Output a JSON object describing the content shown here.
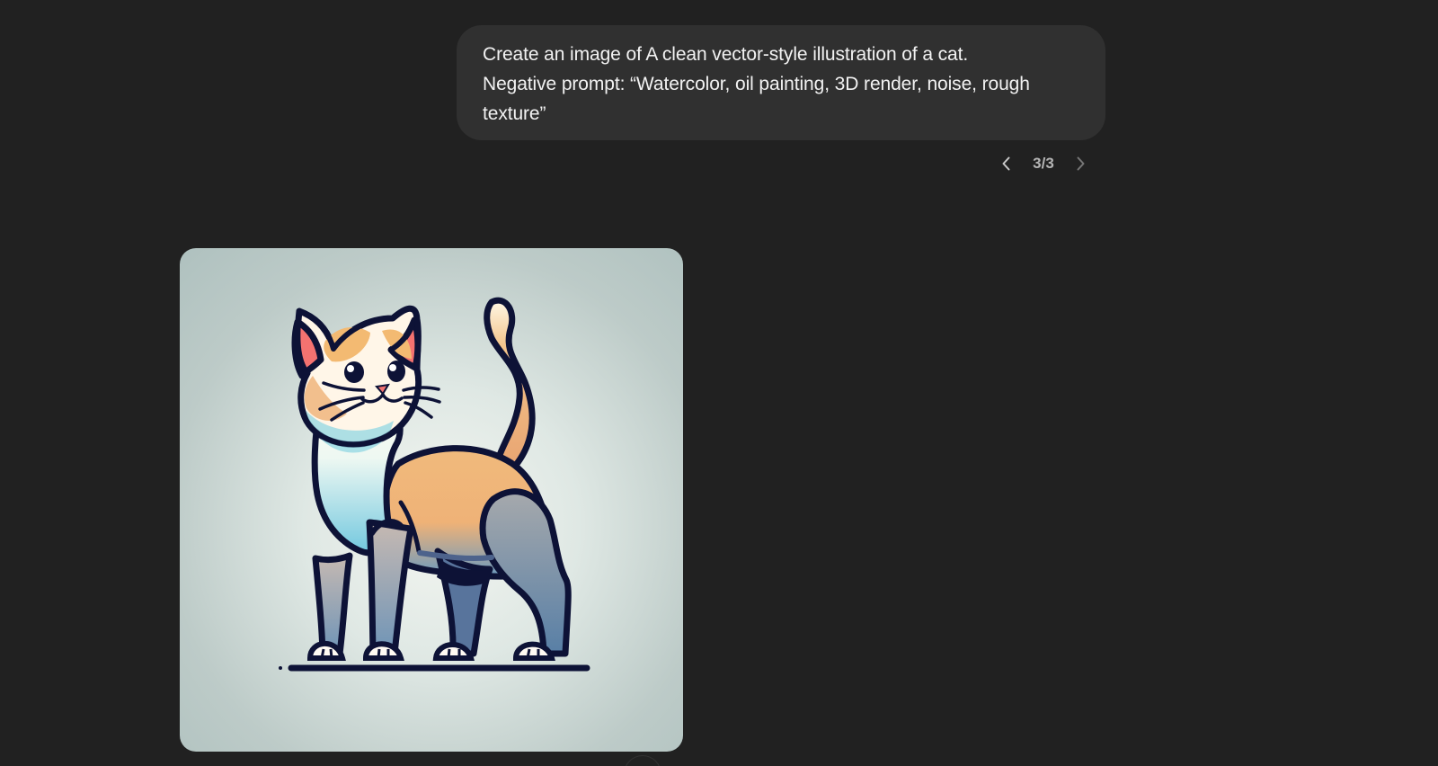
{
  "conversation": {
    "user_message": {
      "lines": [
        "Create an image of A clean vector-style illustration of a cat.",
        "Negative prompt: “Watercolor, oil painting, 3D render, noise, rough",
        "texture”"
      ]
    },
    "pager": {
      "count": "3/3",
      "previous_icon": "chevron-left-icon",
      "next_icon": "chevron-right-icon"
    },
    "generated_image": {
      "subject_icon": "cat-illustration",
      "background_color": "#c7d3cf",
      "outline_color": "#0d1236",
      "orange_color": "#f0b97d",
      "blue_color": "#6b8db8"
    }
  }
}
